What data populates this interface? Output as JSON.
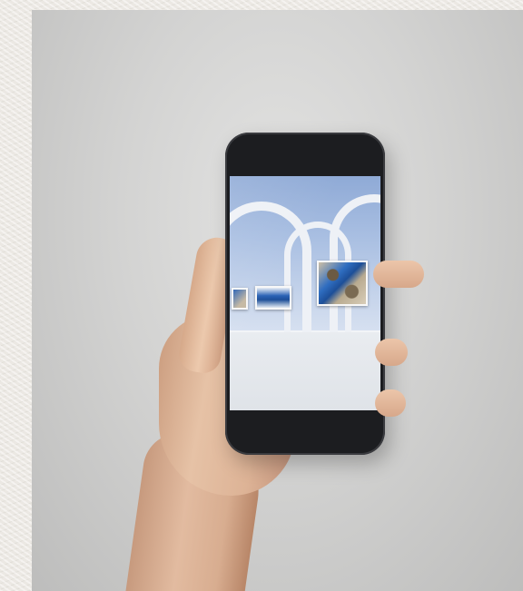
{
  "scene": {
    "description_icon": "hand-holding-phone",
    "colors": {
      "background": "#d3d3d2",
      "phone_body": "#1c1d20",
      "sky": "#a9bfe2",
      "art_blue": "#1d4f98"
    }
  },
  "phone_screen": {
    "icon": "virtual-gallery-view"
  }
}
